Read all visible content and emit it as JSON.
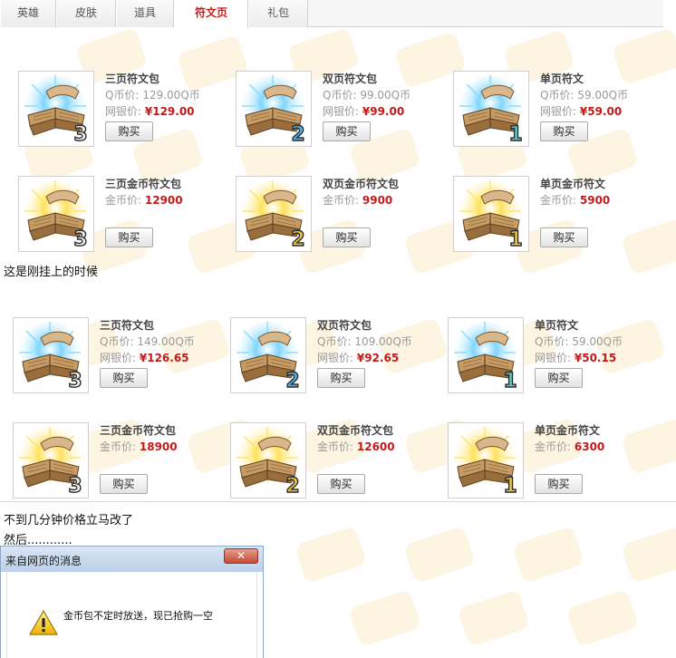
{
  "tabs": [
    {
      "label": "英雄"
    },
    {
      "label": "皮肤"
    },
    {
      "label": "道具"
    },
    {
      "label": "符文页"
    },
    {
      "label": "礼包"
    }
  ],
  "active_tab": "符文页",
  "section_before": {
    "items": [
      {
        "name": "三页符文包",
        "line1_label": "Q币价:",
        "line1_value": "129.00Q币",
        "line2_label": "网银价:",
        "line2_value": "¥129.00",
        "buy_label": "购买",
        "badge": "3",
        "glow": "blue"
      },
      {
        "name": "双页符文包",
        "line1_label": "Q币价:",
        "line1_value": "99.00Q币",
        "line2_label": "网银价:",
        "line2_value": "¥99.00",
        "buy_label": "购买",
        "badge": "2",
        "glow": "blue"
      },
      {
        "name": "单页符文",
        "line1_label": "Q币价:",
        "line1_value": "59.00Q币",
        "line2_label": "网银价:",
        "line2_value": "¥59.00",
        "buy_label": "购买",
        "badge": "1",
        "glow": "blue"
      },
      {
        "name": "三页金币符文包",
        "line1_label": "金币价:",
        "line1_value": "12900",
        "buy_label": "购买",
        "badge": "3",
        "glow": "gold"
      },
      {
        "name": "双页金币符文包",
        "line1_label": "金币价:",
        "line1_value": "9900",
        "buy_label": "购买",
        "badge": "2",
        "glow": "gold"
      },
      {
        "name": "单页金币符文",
        "line1_label": "金币价:",
        "line1_value": "5900",
        "buy_label": "购买",
        "badge": "1",
        "glow": "gold"
      }
    ]
  },
  "caption_1": "这是刚挂上的时候",
  "section_after": {
    "items": [
      {
        "name": "三页符文包",
        "line1_label": "Q币价:",
        "line1_value": "149.00Q币",
        "line2_label": "网银价:",
        "line2_value": "¥126.65",
        "buy_label": "购买",
        "badge": "3",
        "glow": "blue"
      },
      {
        "name": "双页符文包",
        "line1_label": "Q币价:",
        "line1_value": "109.00Q币",
        "line2_label": "网银价:",
        "line2_value": "¥92.65",
        "buy_label": "购买",
        "badge": "2",
        "glow": "blue"
      },
      {
        "name": "单页符文",
        "line1_label": "Q币价:",
        "line1_value": "59.00Q币",
        "line2_label": "网银价:",
        "line2_value": "¥50.15",
        "buy_label": "购买",
        "badge": "1",
        "glow": "blue"
      },
      {
        "name": "三页金币符文包",
        "line1_label": "金币价:",
        "line1_value": "18900",
        "buy_label": "购买",
        "badge": "3",
        "glow": "gold"
      },
      {
        "name": "双页金币符文包",
        "line1_label": "金币价:",
        "line1_value": "12600",
        "buy_label": "购买",
        "badge": "2",
        "glow": "gold"
      },
      {
        "name": "单页金币符文",
        "line1_label": "金币价:",
        "line1_value": "6300",
        "buy_label": "购买",
        "badge": "1",
        "glow": "gold"
      }
    ]
  },
  "caption_2": "不到几分钟价格立马改了",
  "caption_3": "然后............",
  "dialog": {
    "title": "来自网页的消息",
    "close_label": "✕",
    "message": "金币包不定时放送，现已抢购一空",
    "icon": "warning-icon"
  },
  "colors": {
    "price_red": "#c41919",
    "active_tab_red": "#c61e1e",
    "glow_blue": "#7fd6ff",
    "glow_gold": "#ffe15a"
  }
}
